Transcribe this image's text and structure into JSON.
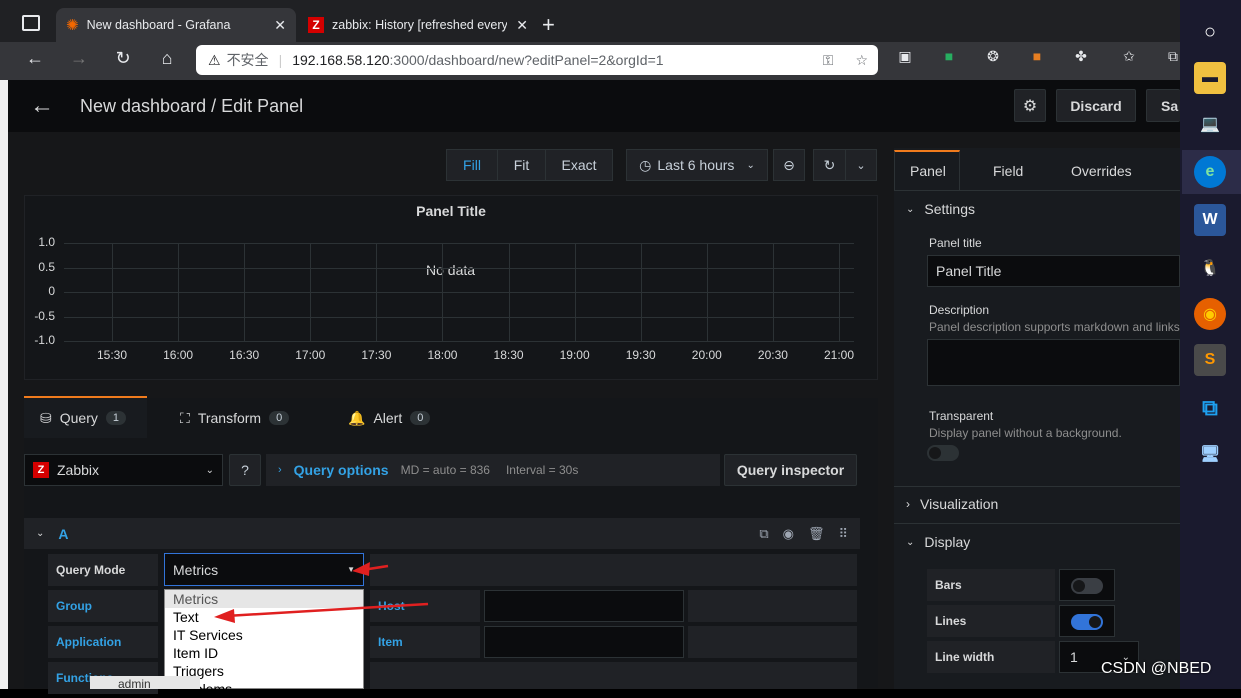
{
  "browser": {
    "tabs": [
      {
        "title": "New dashboard - Grafana"
      },
      {
        "title": "zabbix: History [refreshed every"
      }
    ],
    "security_label": "不安全",
    "url_host": "192.168.58.120",
    "url_rest": ":3000/dashboard/new?editPanel=2&orgId=1"
  },
  "header": {
    "title": "New dashboard / Edit Panel",
    "discard_label": "Discard",
    "save_label": "Sa"
  },
  "view_toggle": {
    "fill": "Fill",
    "fit": "Fit",
    "exact": "Exact"
  },
  "time_picker": {
    "label": "Last 6 hours"
  },
  "panel": {
    "title": "Panel Title",
    "no_data": "No data",
    "y_ticks": [
      "1.0",
      "0.5",
      "0",
      "-0.5",
      "-1.0"
    ],
    "x_ticks": [
      "15:30",
      "16:00",
      "16:30",
      "17:00",
      "17:30",
      "18:00",
      "18:30",
      "19:00",
      "19:30",
      "20:00",
      "20:30",
      "21:00"
    ]
  },
  "query_tabs": [
    {
      "label": "Query",
      "count": "1"
    },
    {
      "label": "Transform",
      "count": "0"
    },
    {
      "label": "Alert",
      "count": "0"
    }
  ],
  "datasource": {
    "name": "Zabbix"
  },
  "query_options": {
    "label": "Query options",
    "md": "MD = auto = 836",
    "interval": "Interval = 30s",
    "inspector": "Query inspector"
  },
  "query": {
    "ref": "A",
    "mode_label": "Query Mode",
    "mode_value": "Metrics",
    "group_label": "Group",
    "host_label": "Host",
    "application_label": "Application",
    "item_label": "Item",
    "functions_label": "Functions",
    "mode_options": [
      "Metrics",
      "Text",
      "IT Services",
      "Item ID",
      "Triggers",
      "Problems"
    ]
  },
  "right_pane": {
    "tabs": [
      "Panel",
      "Field",
      "Overrides"
    ],
    "settings": "Settings",
    "panel_title_label": "Panel title",
    "panel_title_value": "Panel Title",
    "description_label": "Description",
    "description_hint": "Panel description supports markdown and links.",
    "transparent_label": "Transparent",
    "transparent_hint": "Display panel without a background.",
    "visualization": "Visualization",
    "display": "Display",
    "bars": "Bars",
    "lines": "Lines",
    "line_width": "Line width",
    "line_width_value": "1"
  },
  "taskbar_hidden": "admin",
  "watermark": "CSDN @NBED"
}
